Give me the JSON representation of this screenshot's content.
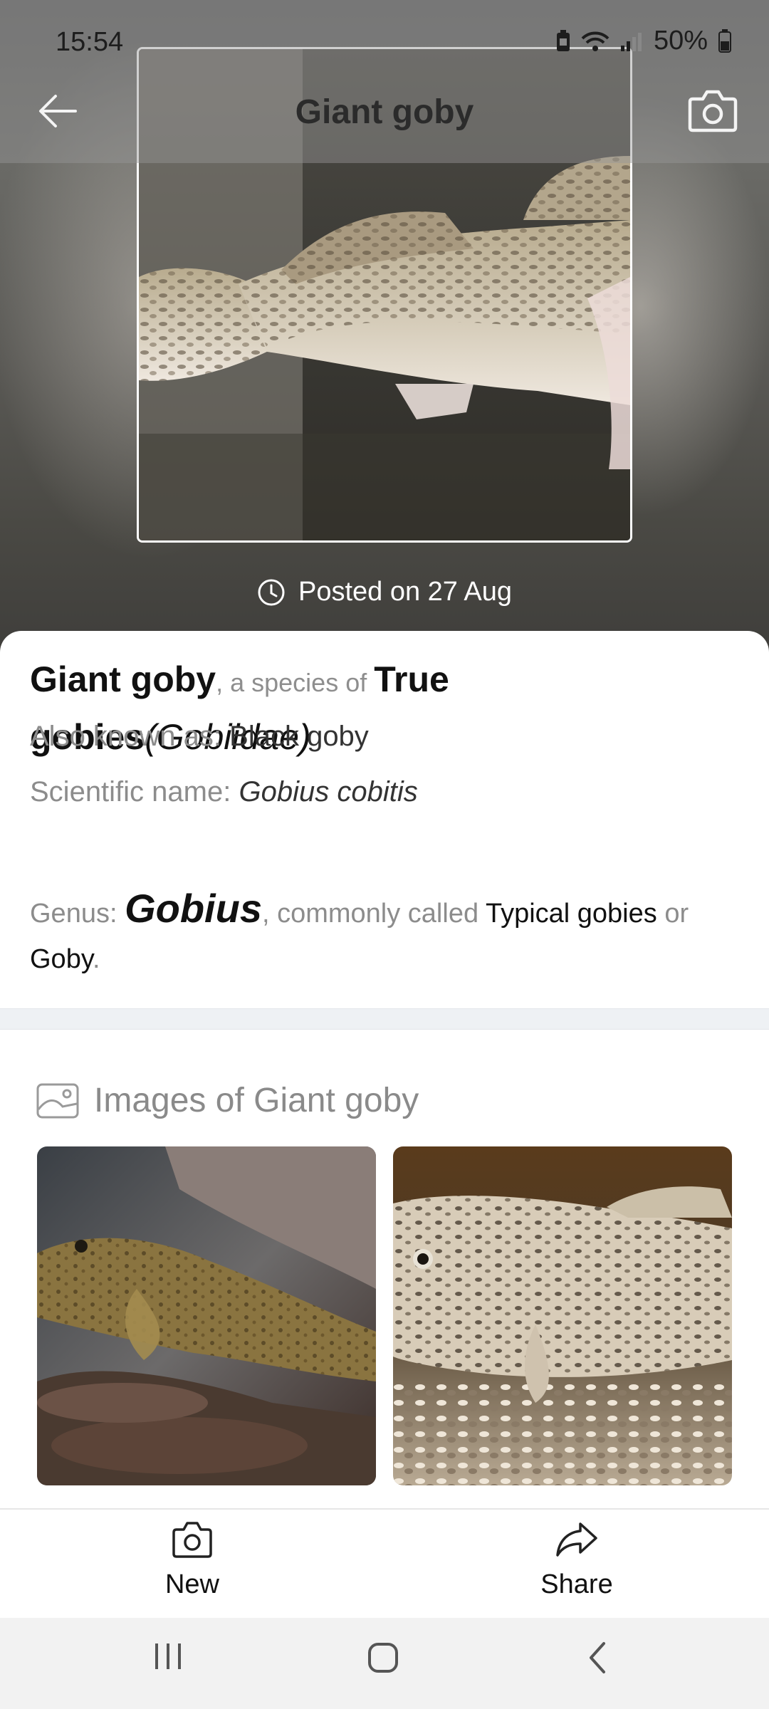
{
  "status_bar": {
    "time": "15:54",
    "battery_percent": "50%",
    "icons": [
      "battery-saver-icon",
      "wifi-icon",
      "signal-icon",
      "battery-icon"
    ]
  },
  "header": {
    "title": "Giant goby",
    "back_icon": "arrow-left-icon",
    "camera_icon": "camera-icon"
  },
  "hero": {
    "posted_text": "Posted on 27 Aug",
    "clock_icon": "clock-icon"
  },
  "species": {
    "common_name": "Giant goby",
    "species_of_text": ", a species of ",
    "family_common": "True gobies",
    "family_scientific": "(Gobiidae)",
    "aka_label": "Also known as: ",
    "aka_value": "Black goby",
    "scientific_label": "Scientific name: ",
    "scientific_value": "Gobius cobitis",
    "genus_label": "Genus: ",
    "genus_value": "Gobius",
    "genus_common_text": ", commonly called ",
    "genus_common_1": "Typical gobies",
    "genus_or_text": " or",
    "genus_common_2": "Goby",
    "genus_end": "."
  },
  "images_section": {
    "title": "Images of Giant goby",
    "icon": "image-icon",
    "thumbnails": [
      "goby-on-rocks",
      "goby-on-shells"
    ]
  },
  "bottom_bar": {
    "new_label": "New",
    "share_label": "Share"
  },
  "system_nav": [
    "recents-icon",
    "home-icon",
    "back-icon"
  ],
  "colors": {
    "accent_text": "#111111",
    "muted_text": "#8c8c8c",
    "separator": "#eef1f4"
  }
}
